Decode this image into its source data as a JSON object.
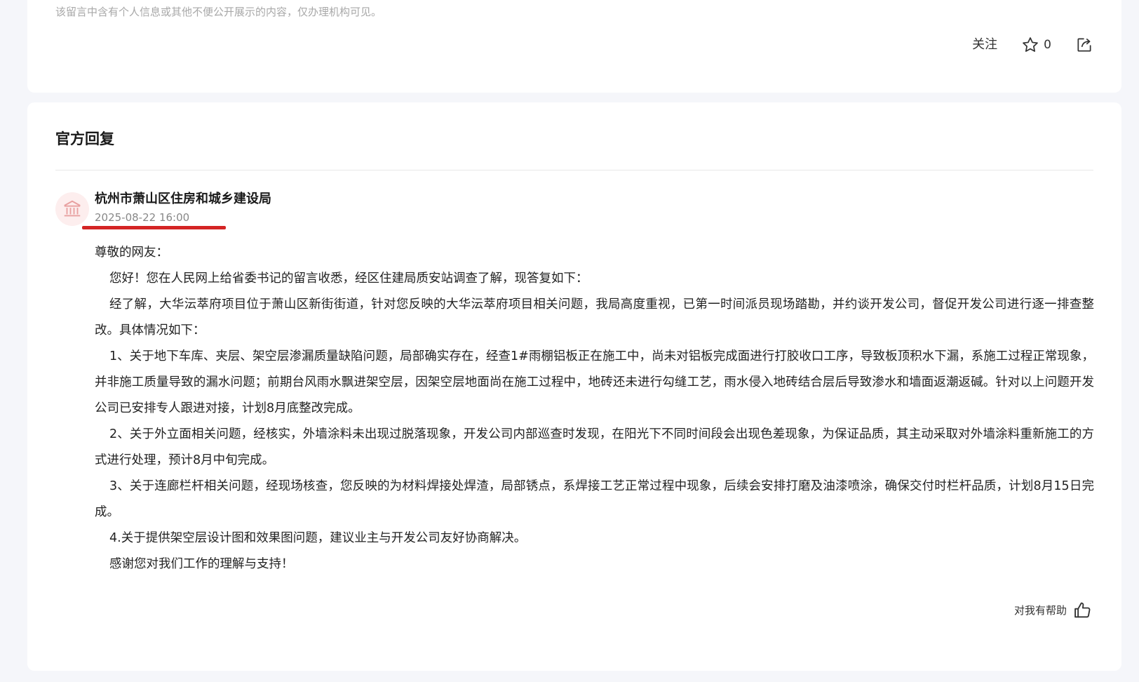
{
  "message": {
    "privacy_notice": "该留言中含有个人信息或其他不便公开展示的内容，仅办理机构可见。",
    "follow_label": "关注",
    "star_count": "0",
    "icons": {
      "star": "star-icon",
      "share": "share-icon"
    }
  },
  "reply": {
    "section_title": "官方回复",
    "org_name": "杭州市萧山区住房和城乡建设局",
    "date": "2025-08-22 16:00",
    "org_icon": "government-building-icon",
    "paragraphs": [
      "尊敬的网友：",
      "您好！您在人民网上给省委书记的留言收悉，经区住建局质安站调查了解，现答复如下：",
      "经了解，大华沄萃府项目位于萧山区新街街道，针对您反映的大华沄萃府项目相关问题，我局高度重视，已第一时间派员现场踏勘，并约谈开发公司，督促开发公司进行逐一排查整改。具体情况如下：",
      "1、关于地下车库、夹层、架空层渗漏质量缺陷问题，局部确实存在，经查1#雨棚铝板正在施工中，尚未对铝板完成面进行打胶收口工序，导致板顶积水下漏，系施工过程正常现象，并非施工质量导致的漏水问题；前期台风雨水飘进架空层，因架空层地面尚在施工过程中，地砖还未进行勾缝工艺，雨水侵入地砖结合层后导致渗水和墙面返潮返碱。针对以上问题开发公司已安排专人跟进对接，计划8月底整改完成。",
      "2、关于外立面相关问题，经核实，外墙涂料未出现过脱落现象，开发公司内部巡查时发现，在阳光下不同时间段会出现色差现象，为保证品质，其主动采取对外墙涂料重新施工的方式进行处理，预计8月中旬完成。",
      "3、关于连廊栏杆相关问题，经现场核查，您反映的为材料焊接处焊渣，局部锈点，系焊接工艺正常过程中现象，后续会安排打磨及油漆喷涂，确保交付时栏杆品质，计划8月15日完成。",
      "4.关于提供架空层设计图和效果图问题，建议业主与开发公司友好协商解决。",
      "感谢您对我们工作的理解与支持！"
    ],
    "helpful_label": "对我有帮助",
    "helpful_icon": "thumbs-up-icon",
    "colors": {
      "highlight": "#d42424",
      "avatar_bg": "#fdeeee",
      "avatar_icon": "#e8a0a0"
    }
  }
}
